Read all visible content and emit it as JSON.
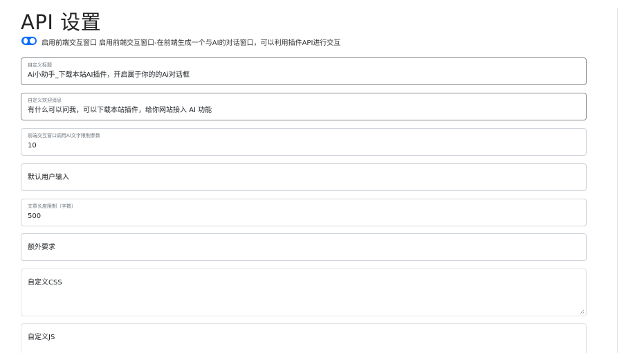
{
  "header": {
    "title": "API 设置"
  },
  "toggle": {
    "label": "启用前端交互窗口 启用前端交互窗口-在前端生成一个与AI的对话窗口，可以利用插件API进行交互",
    "enabled": true,
    "accent": "#0d6efd"
  },
  "fields": [
    {
      "label": "自定义标题",
      "value": "Ai小助手_下载本站AI插件，开启属于你的的Ai对话框"
    },
    {
      "label": "自定义欢迎消息",
      "value": "有什么可以问我，可以下载本站插件，给你网站接入 AI 功能"
    },
    {
      "label": "前端交互窗口调用AI文字限制参数",
      "value": "10"
    },
    {
      "placeholder": "默认用户输入"
    },
    {
      "label": "文章长度限制（字数）",
      "value": "500"
    },
    {
      "placeholder": "额外要求"
    }
  ],
  "textareas": [
    {
      "placeholder": "自定义CSS"
    },
    {
      "placeholder": "自定义JS"
    }
  ]
}
